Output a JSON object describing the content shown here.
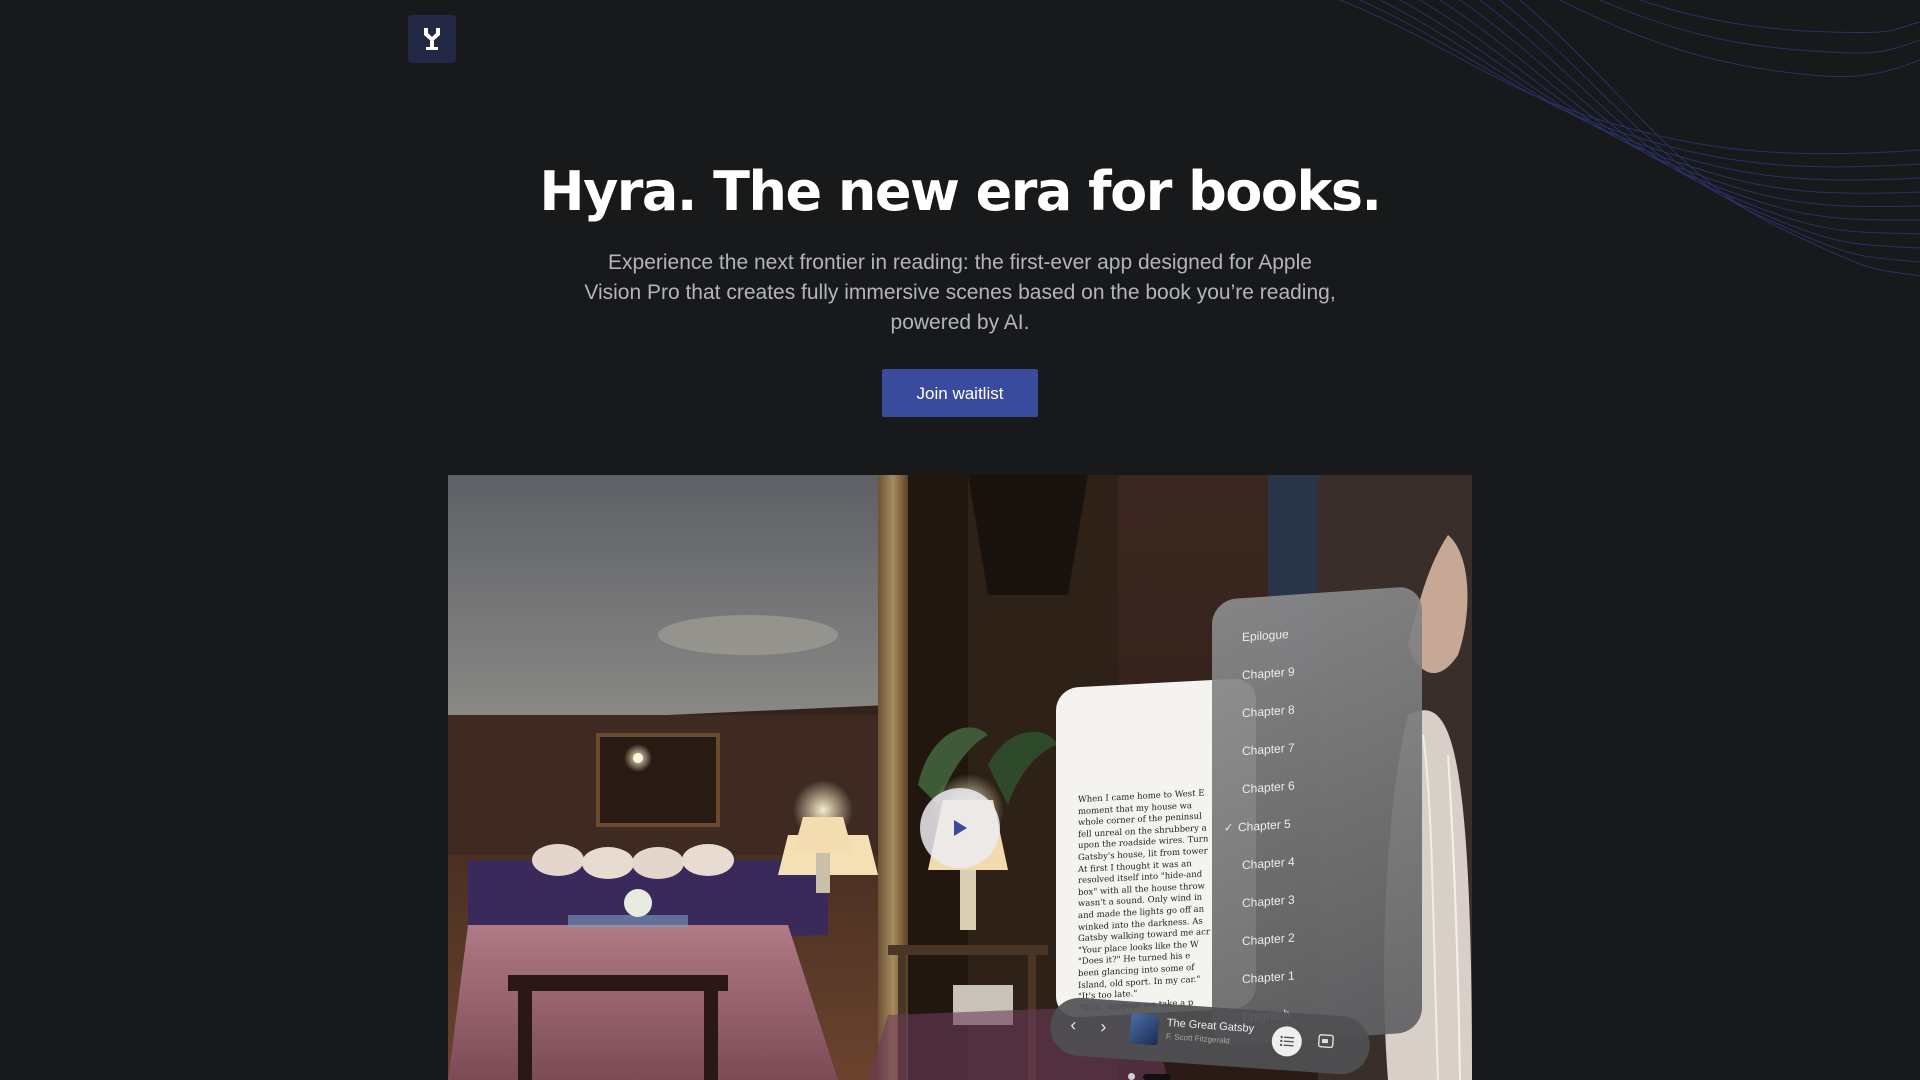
{
  "brand": {
    "logo_icon": "hyra-logo-icon"
  },
  "hero": {
    "title": "Hyra. The new era for books.",
    "subtitle": "Experience the next frontier in reading: the first-ever app designed for Apple Vision Pro that creates fully immersive scenes based on the book you’re reading, powered by AI.",
    "cta_label": "Join waitlist"
  },
  "video": {
    "play_icon": "play-icon",
    "toc": {
      "items": [
        "Epilogue",
        "Chapter 9",
        "Chapter 8",
        "Chapter 7",
        "Chapter 6",
        "Chapter 5",
        "Chapter 4",
        "Chapter 3",
        "Chapter 2",
        "Chapter 1",
        "Epigraph"
      ],
      "selected": "Chapter 5"
    },
    "page_text": "When I came home to West E\nmoment that my house wa\nwhole corner of the peninsul\nfell unreal on the shrubbery a\nupon the roadside wires. Turn\nGatsby's house, lit from tower\n  At first I thought it was an\nresolved itself into \"hide-and\nbox\" with all the house throw\nwasn't a sound. Only wind in\nand made the lights go off an\nwinked into the darkness. As\nGatsby walking toward me acr\n  \"Your place looks like the W\n  \"Does it?\" He turned his e\nbeen glancing into some of\nIsland, old sport. In my car.\"\n  \"It's too late.\"\n  \"Well, suppose we take a p",
    "book": {
      "title": "The Great Gatsby",
      "author": "F. Scott Fitzgerald"
    }
  },
  "colors": {
    "background": "#18191b",
    "accent": "#3a4a9c",
    "logo_bg": "#232845"
  }
}
